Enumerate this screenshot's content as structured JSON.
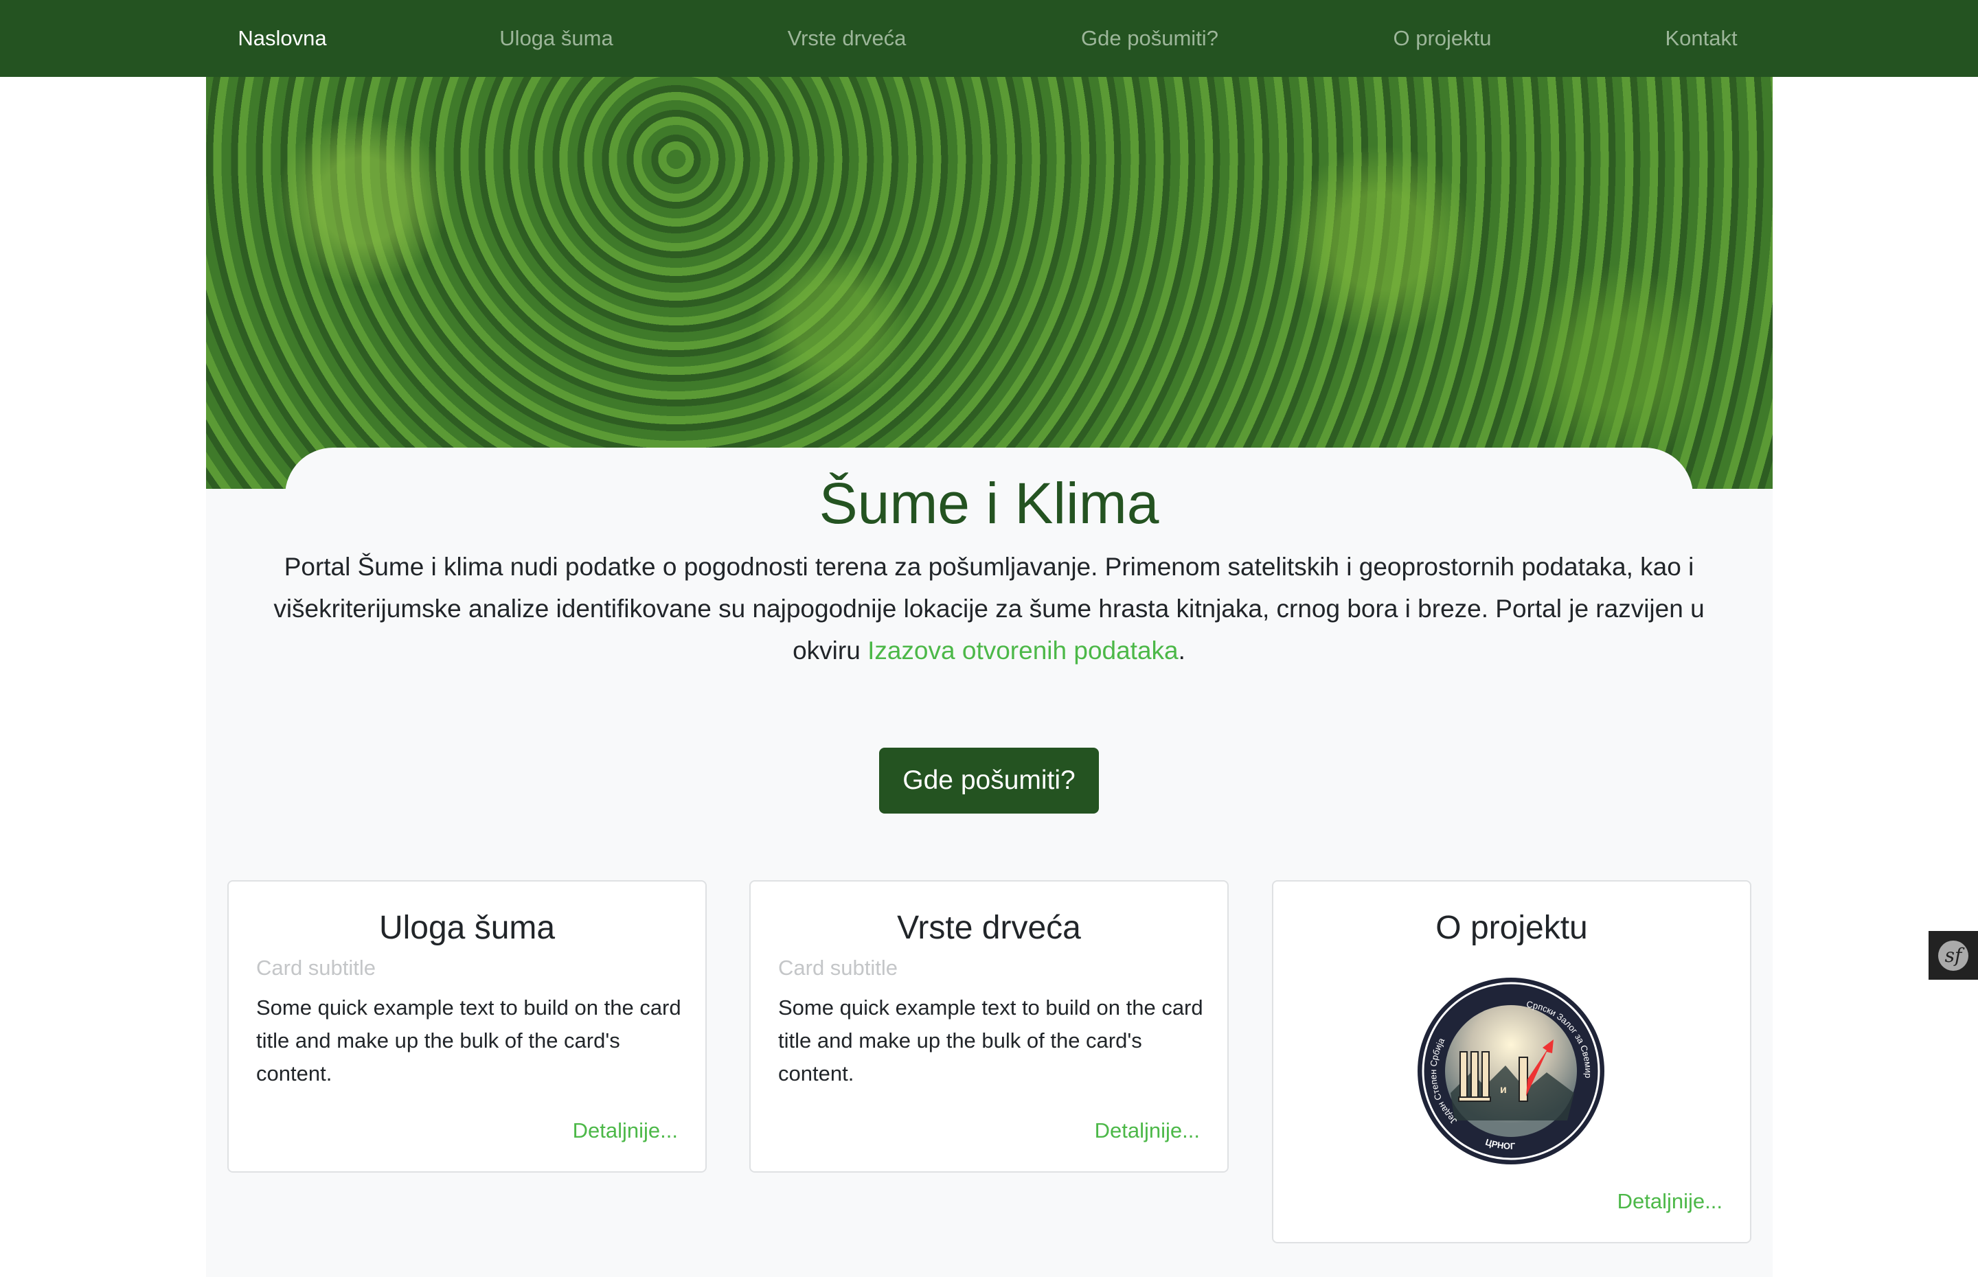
{
  "nav": {
    "items": [
      {
        "label": "Naslovna",
        "active": true
      },
      {
        "label": "Uloga šuma"
      },
      {
        "label": "Vrste drveća"
      },
      {
        "label": "Gde pošumiti?"
      },
      {
        "label": "O projektu"
      },
      {
        "label": "Kontakt"
      }
    ]
  },
  "hero": {
    "title": "Šume i Klima",
    "intro_text": "Portal Šume i klima nudi podatke o pogodnosti terena za pošumljavanje. Primenom satelitskih i geoprostornih podataka, kao i višekriterijumske analize identifikovane su najpogodnije lokacije za šume hrasta kitnjaka, crnog bora i breze. Portal je razvijen u okviru ",
    "intro_link": "Izazova otvorenih podataka",
    "intro_end": ".",
    "cta": "Gde pošumiti?"
  },
  "cards": [
    {
      "title": "Uloga šuma",
      "subtitle": "Card subtitle",
      "text": "Some quick example text to build on the card title and make up the bulk of the card's content.",
      "link": "Detaljnije..."
    },
    {
      "title": "Vrste drveća",
      "subtitle": "Card subtitle",
      "text": "Some quick example text to build on the card title and make up the bulk of the card's content.",
      "link": "Detaljnije..."
    },
    {
      "title": "O projektu",
      "logo_text": [
        "Један Степен Србија",
        "Српски Залог за Свемир",
        "ЦРНОГ",
        "Ш и К"
      ],
      "link": "Detaljnije..."
    }
  ],
  "colors": {
    "nav": "#245321",
    "accent": "#4cb848",
    "background": "#f8f9fa"
  },
  "toolbar_icon": "symfony-icon"
}
